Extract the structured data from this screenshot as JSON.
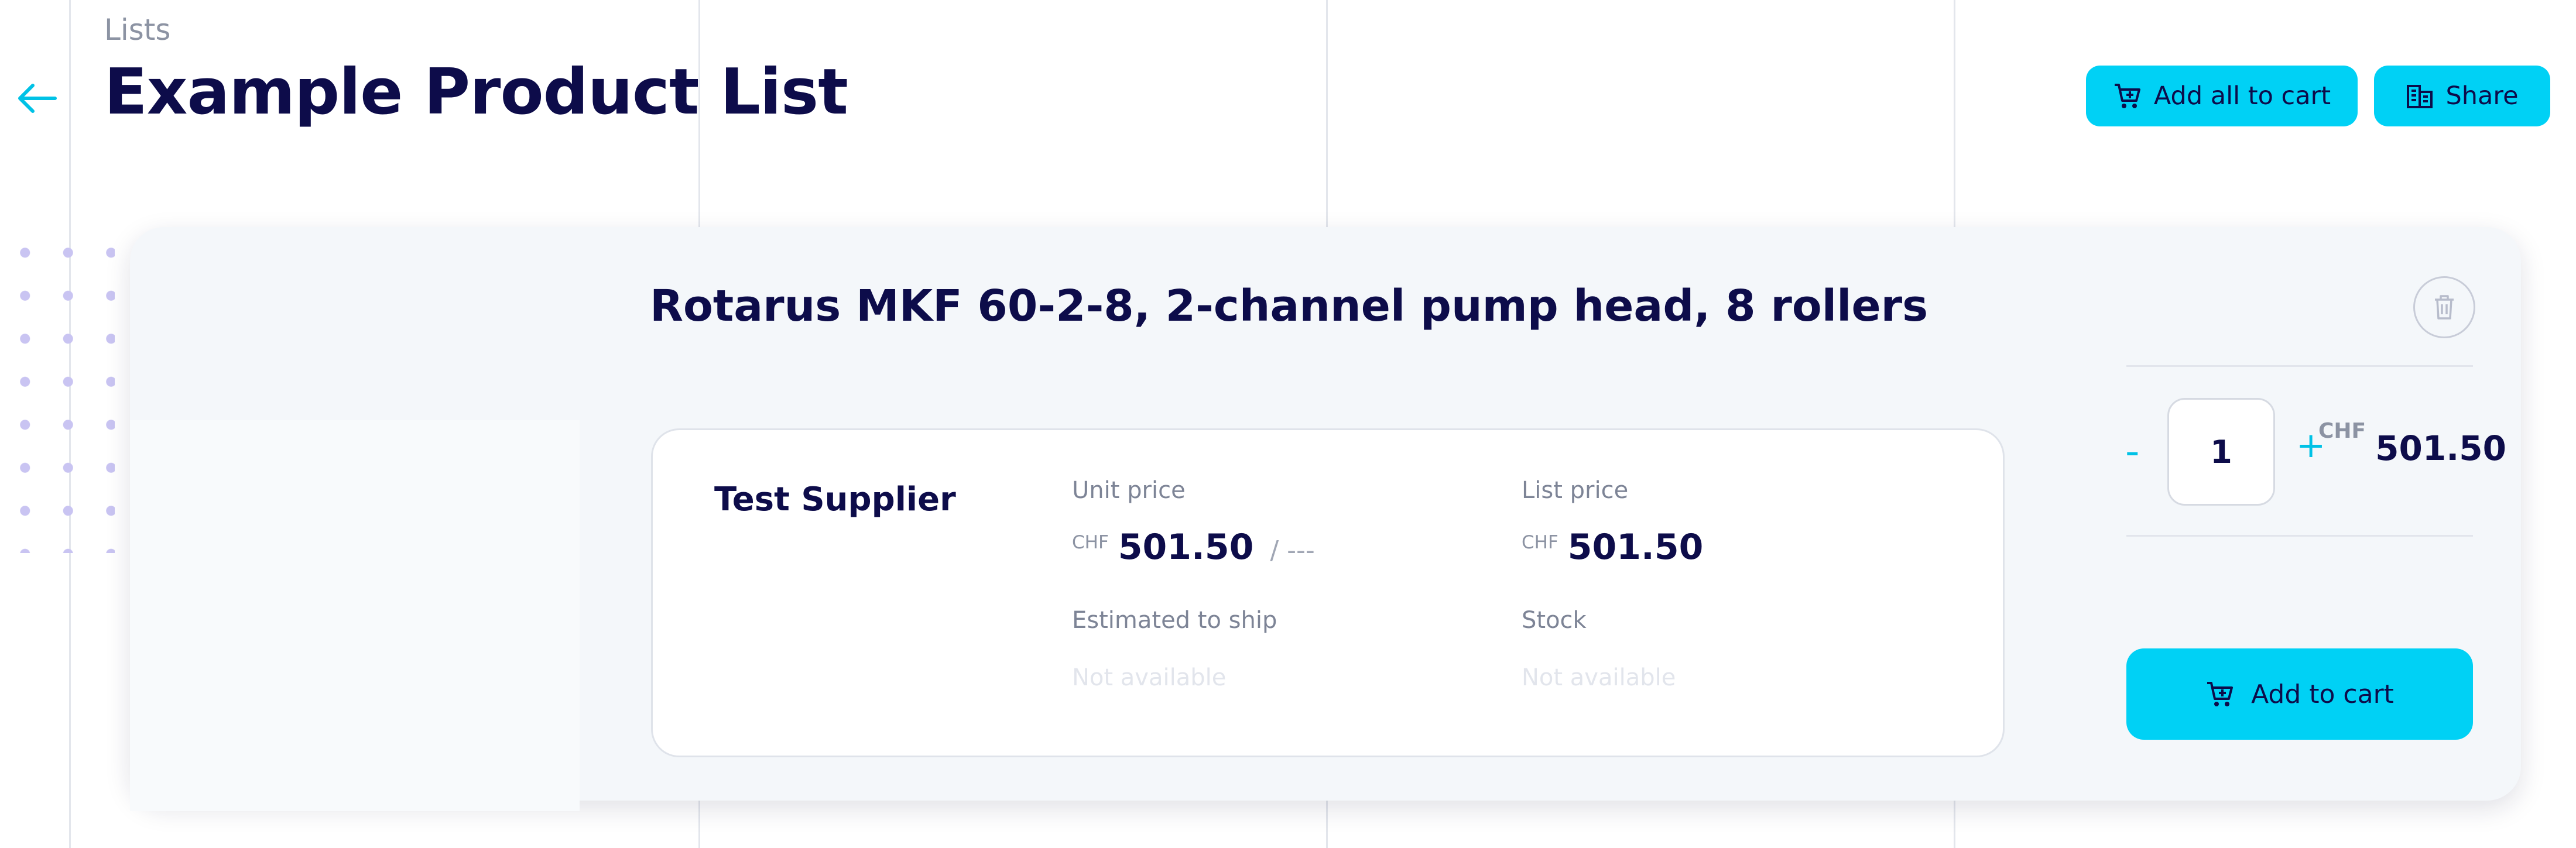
{
  "header": {
    "breadcrumb": "Lists",
    "title": "Example Product List",
    "add_all_label": "Add all to cart",
    "share_label": "Share"
  },
  "product": {
    "title": "Rotarus MKF 60-2-8, 2-channel pump head, 8 rollers",
    "offer": {
      "supplier": "Test Supplier",
      "unit_price_label": "Unit price",
      "unit_price_currency": "CHF",
      "unit_price_value": "501.50",
      "unit_price_per": "/ ---",
      "list_price_label": "List price",
      "list_price_currency": "CHF",
      "list_price_value": "501.50",
      "ship_label": "Estimated to ship",
      "ship_value": "Not available",
      "stock_label": "Stock",
      "stock_value": "Not available"
    },
    "quantity": {
      "minus": "-",
      "value": "1",
      "plus": "+"
    },
    "total": {
      "currency": "CHF",
      "value": "501.50"
    },
    "add_to_cart_label": "Add to cart"
  },
  "colors": {
    "accent": "#00d1f5",
    "text_dark": "#0d0c4a",
    "muted": "#8c93a3",
    "card_bg": "#f4f7fa",
    "dots": "#c9c4f2"
  },
  "icons": [
    "arrow-left-icon",
    "cart-plus-icon",
    "building-icon",
    "trash-icon"
  ]
}
